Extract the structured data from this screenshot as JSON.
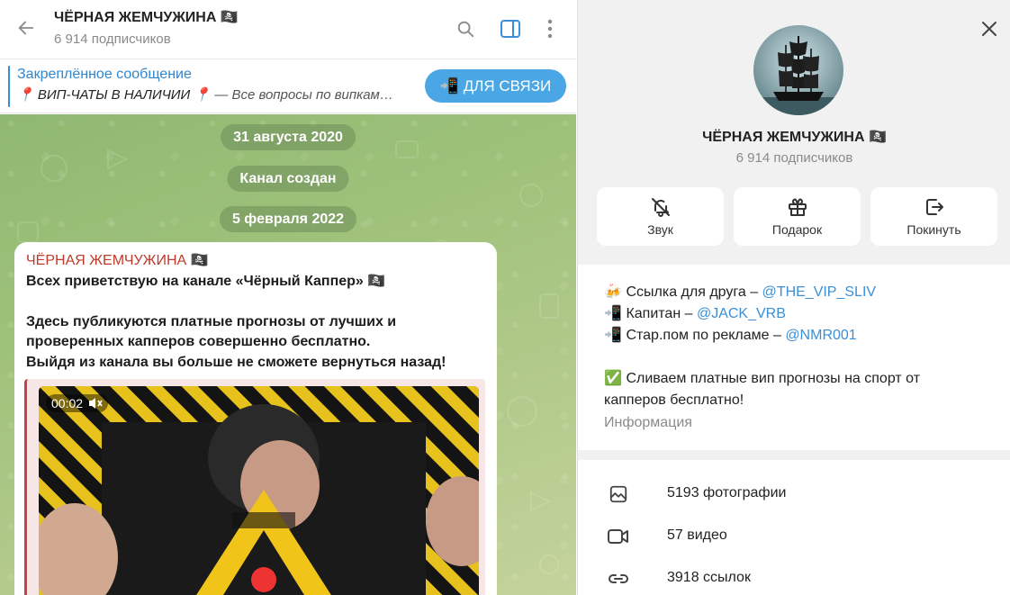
{
  "chat": {
    "title": "ЧЁРНАЯ ЖЕМЧУЖИНА 🏴‍☠️",
    "subscribers": "6 914 подписчиков"
  },
  "pinned": {
    "title": "Закреплённое сообщение",
    "text_main": "📍 ВИП-ЧАТЫ В НАЛИЧИИ 📍",
    "text_rest": " — Все вопросы по випкам…",
    "button_label": "📲 ДЛЯ СВЯЗИ"
  },
  "dates": {
    "first": "31 августа 2020",
    "event": "Канал создан",
    "second": "5 февраля 2022"
  },
  "message": {
    "author": "ЧЁРНАЯ ЖЕМЧУЖИНА 🏴‍☠️",
    "line1": "Всех приветствую на канале «Чёрный Каппер» 🏴‍☠️",
    "line2": "Здесь публикуются платные прогнозы от лучших и",
    "line3": "проверенных капперов совершенно бесплатно.",
    "line4": "Выйдя из канала вы больше не сможете вернуться назад!",
    "video_time": "00:02"
  },
  "panel": {
    "title": "ЧЁРНАЯ ЖЕМЧУЖИНА 🏴‍☠️",
    "subscribers": "6 914 подписчиков",
    "actions": {
      "sound": "Звук",
      "gift": "Подарок",
      "leave": "Покинуть"
    },
    "info": {
      "friend_label": "Ссылка для друга – ",
      "friend_link": "@THE_VIP_SLIV",
      "captain_label": "Капитан – ",
      "captain_link": "@JACK_VRB",
      "ads_label": "Стар.пом по рекламе – ",
      "ads_link": "@NMR001",
      "desc1": "Сливаем платные вип прогнозы на спорт от",
      "desc2": "капперов бесплатно!",
      "caption": "Информация",
      "emoji_friend": "🍻",
      "emoji_phone": "📲",
      "emoji_check": "✅"
    },
    "stats": {
      "photos": "5193 фотографии",
      "videos": "57 видео",
      "links": "3918 ссылок"
    }
  },
  "colors": {
    "accent": "#3a8fd6",
    "author": "#c0392b",
    "button": "#4aa6e4"
  }
}
